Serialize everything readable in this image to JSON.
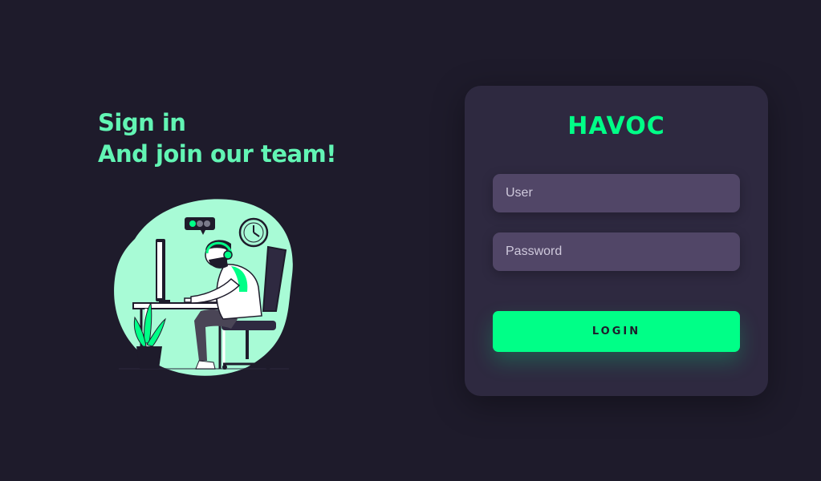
{
  "hero": {
    "line1": "Sign in",
    "line2": "And join our team!"
  },
  "illustration": {
    "icon": "developer-at-desk-illustration",
    "accent_color": "#00ff87",
    "blob_color": "#a8fbd6"
  },
  "login_card": {
    "brand": "HAVOC",
    "user_placeholder": "User",
    "user_value": "",
    "password_placeholder": "Password",
    "password_value": "",
    "login_label": "LOGIN"
  },
  "colors": {
    "background": "#1e1b2b",
    "card": "#2e2940",
    "input": "#514667",
    "accent": "#00ff87",
    "headline": "#62f5b4"
  }
}
